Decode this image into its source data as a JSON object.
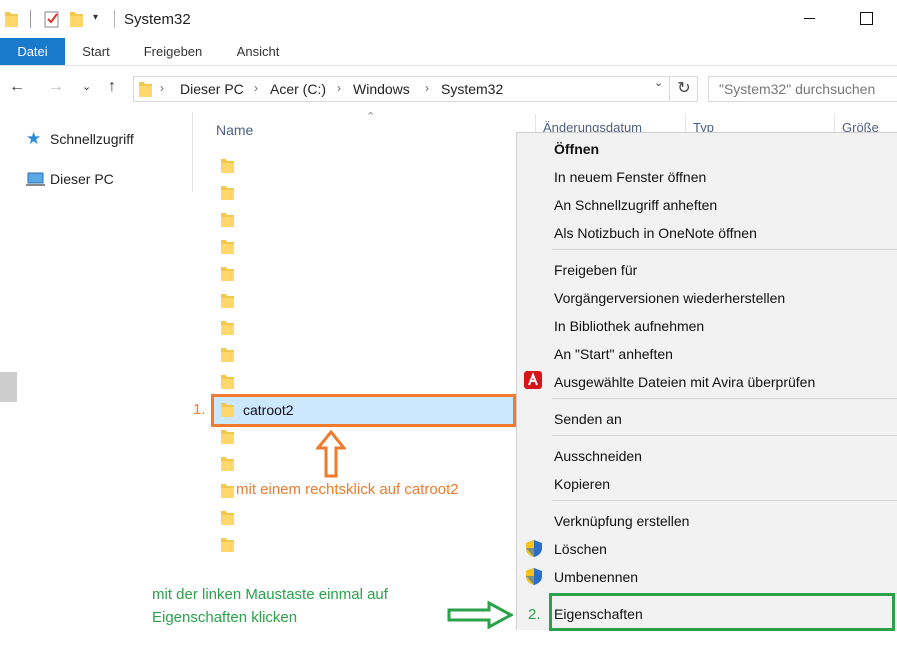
{
  "window": {
    "title": "System32"
  },
  "ribbon": {
    "tabs": [
      "Datei",
      "Start",
      "Freigeben",
      "Ansicht"
    ]
  },
  "address": {
    "breadcrumbs": [
      "Dieser PC",
      "Acer (C:)",
      "Windows",
      "System32"
    ],
    "search_placeholder": "\"System32\" durchsuchen"
  },
  "navpane": {
    "items": [
      {
        "label": "Schnellzugriff",
        "icon": "star-icon"
      },
      {
        "label": "Dieser PC",
        "icon": "computer-icon"
      }
    ]
  },
  "filelist": {
    "columns": [
      "Name",
      "Änderungsdatum",
      "Typ",
      "Größe"
    ],
    "selected_item": "catroot2"
  },
  "context_menu": {
    "groups": [
      [
        "Öffnen",
        "In neuem Fenster öffnen",
        "An Schnellzugriff anheften",
        "Als Notizbuch in OneNote öffnen"
      ],
      [
        "Freigeben für",
        "Vorgängerversionen wiederherstellen",
        "In Bibliothek aufnehmen",
        "An \"Start\" anheften",
        "Ausgewählte Dateien mit Avira überprüfen"
      ],
      [
        "Senden an"
      ],
      [
        "Ausschneiden",
        "Kopieren"
      ],
      [
        "Verknüpfung erstellen",
        "Löschen",
        "Umbenennen"
      ],
      [
        "Eigenschaften"
      ]
    ]
  },
  "annotations": {
    "step1_number": "1.",
    "step1_text": "mit einem rechtsklick auf catroot2",
    "step2_number": "2.",
    "step2_text_line1": "mit der linken Maustaste einmal auf",
    "step2_text_line2": "Eigenschaften klicken",
    "colors": {
      "orange": "#f07b2c",
      "green": "#2aa24a",
      "selection": "#cce8ff",
      "accent": "#1979ca"
    }
  }
}
